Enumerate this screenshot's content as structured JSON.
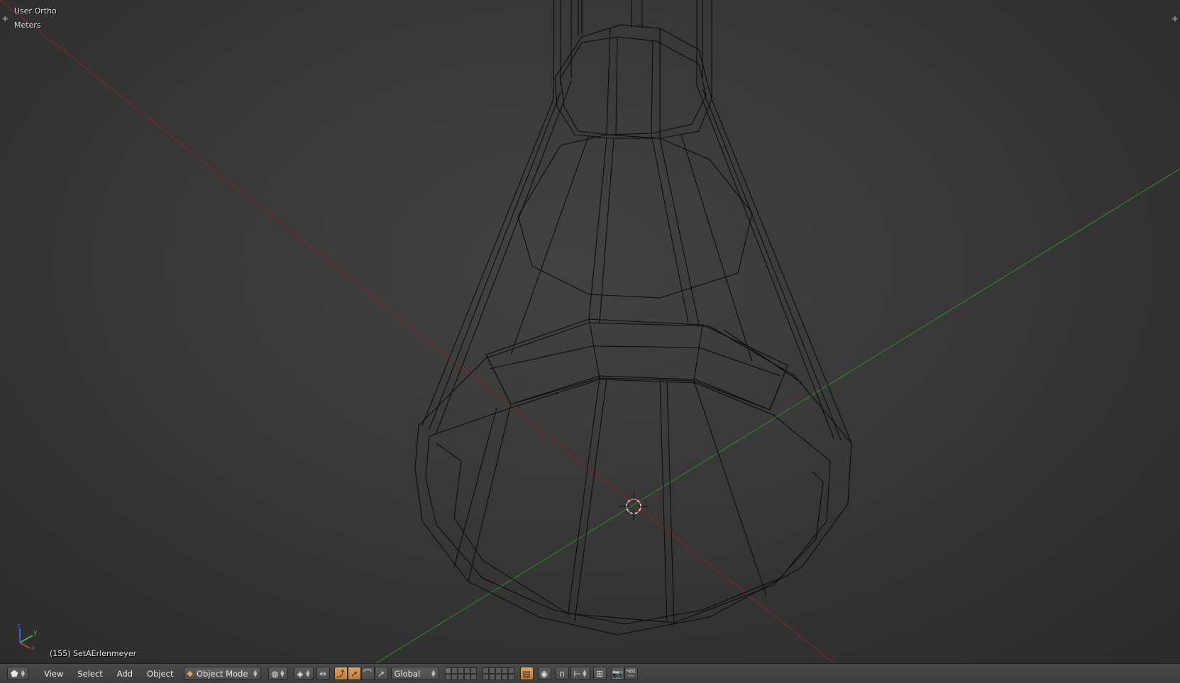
{
  "viewport": {
    "view_name": "User Ortho",
    "units": "Meters",
    "object_info": "(155) SetAErlenmeyer",
    "colors": {
      "x_axis": "#8c2525",
      "y_axis": "#2f8a2f",
      "wire": "#0c0c0c"
    },
    "gizmo": {
      "x": "x",
      "y": "y",
      "z": "z"
    }
  },
  "header": {
    "editor_type_icon": "3d-view-icon",
    "menus": [
      "View",
      "Select",
      "Add",
      "Object"
    ],
    "mode": "Object Mode",
    "pivot_icon": "pivot-icon",
    "transform_orientation": "Global",
    "accent": "#e3a15a"
  }
}
